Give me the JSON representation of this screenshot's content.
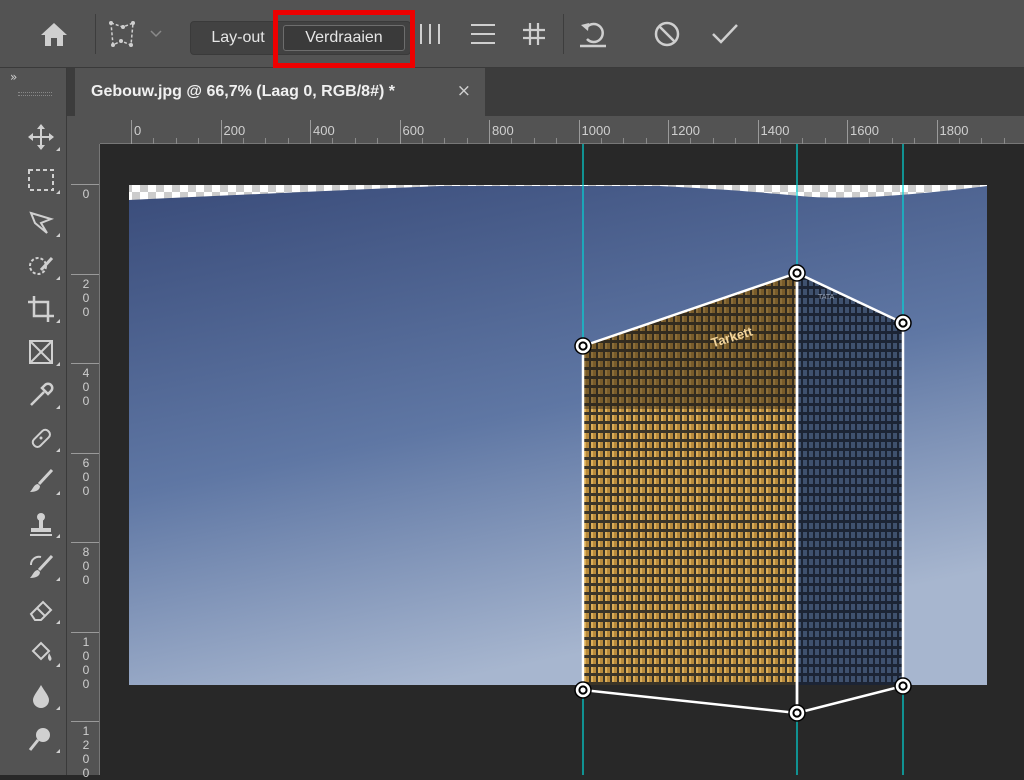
{
  "options_bar": {
    "home_icon": "home-icon",
    "warp_mode_icon": "perspective-warp-icon",
    "layout_label": "Lay-out",
    "warp_label": "Verdraaien",
    "auto_vertical_icon": "vertical-lines-icon",
    "auto_horizontal_icon": "horizontal-lines-icon",
    "auto_grid_icon": "grid-hash-icon",
    "reset_icon": "undo-icon",
    "cancel_icon": "cancel-icon",
    "commit_icon": "checkmark-icon",
    "highlight_color": "#ee0000"
  },
  "toolbar": {
    "collapse_label": "»",
    "tools": [
      "move-tool-icon",
      "marquee-tool-icon",
      "lasso-tool-icon",
      "quick-selection-tool-icon",
      "crop-tool-icon",
      "frame-tool-icon",
      "eyedropper-tool-icon",
      "healing-brush-tool-icon",
      "brush-tool-icon",
      "clone-stamp-tool-icon",
      "history-brush-tool-icon",
      "eraser-tool-icon",
      "paint-bucket-tool-icon",
      "blur-tool-icon",
      "dodge-tool-icon"
    ]
  },
  "document": {
    "tab_title": "Gebouw.jpg @ 66,7% (Laag 0, RGB/8#) *",
    "close_glyph": "×",
    "facade_text": "Tarkett",
    "side_text": "TATA"
  },
  "ruler": {
    "horizontal": [
      "0",
      "200",
      "400",
      "600",
      "800",
      "1000",
      "1200",
      "1400",
      "1600",
      "1800"
    ],
    "vertical": [
      "0",
      "200",
      "400",
      "600",
      "800",
      "1000",
      "1200"
    ]
  },
  "colors": {
    "guide": "#00d8d8",
    "sky_top": "#3a4c7a",
    "sky_bottom": "#a7b6cf"
  }
}
